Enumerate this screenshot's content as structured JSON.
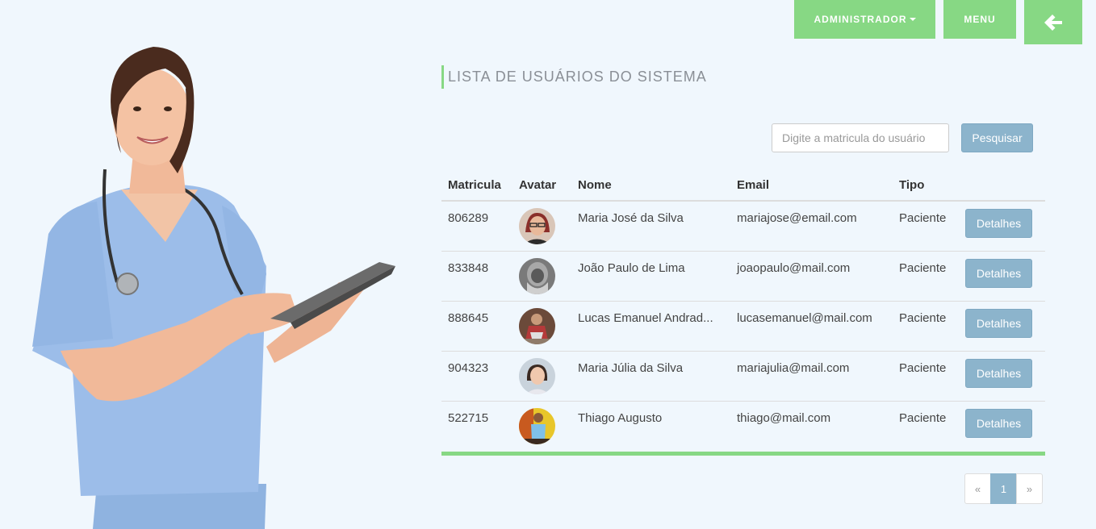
{
  "nav": {
    "admin_label": "ADMINISTRADOR",
    "menu_label": "MENU",
    "back_icon": "arrow-left-icon"
  },
  "page_title": "LISTA DE USUÁRIOS DO SISTEMA",
  "search": {
    "placeholder": "Digite a matricula do usuário",
    "value": "",
    "button_label": "Pesquisar"
  },
  "table": {
    "headers": [
      "Matricula",
      "Avatar",
      "Nome",
      "Email",
      "Tipo"
    ],
    "rows": [
      {
        "matricula": "806289",
        "nome": "Maria José da Silva",
        "email": "mariajose@email.com",
        "tipo": "Paciente",
        "details_label": "Detalhes"
      },
      {
        "matricula": "833848",
        "nome": "João Paulo de Lima",
        "email": "joaopaulo@mail.com",
        "tipo": "Paciente",
        "details_label": "Detalhes"
      },
      {
        "matricula": "888645",
        "nome": "Lucas Emanuel Andrad...",
        "email": "lucasemanuel@mail.com",
        "tipo": "Paciente",
        "details_label": "Detalhes"
      },
      {
        "matricula": "904323",
        "nome": "Maria Júlia da Silva",
        "email": "mariajulia@mail.com",
        "tipo": "Paciente",
        "details_label": "Detalhes"
      },
      {
        "matricula": "522715",
        "nome": "Thiago Augusto",
        "email": "thiago@mail.com",
        "tipo": "Paciente",
        "details_label": "Detalhes"
      }
    ]
  },
  "pagination": {
    "prev": "«",
    "current": "1",
    "next": "»"
  },
  "colors": {
    "accent_green": "#87d884",
    "button_blue": "#8cb4cc",
    "background": "#f0f7fd"
  }
}
